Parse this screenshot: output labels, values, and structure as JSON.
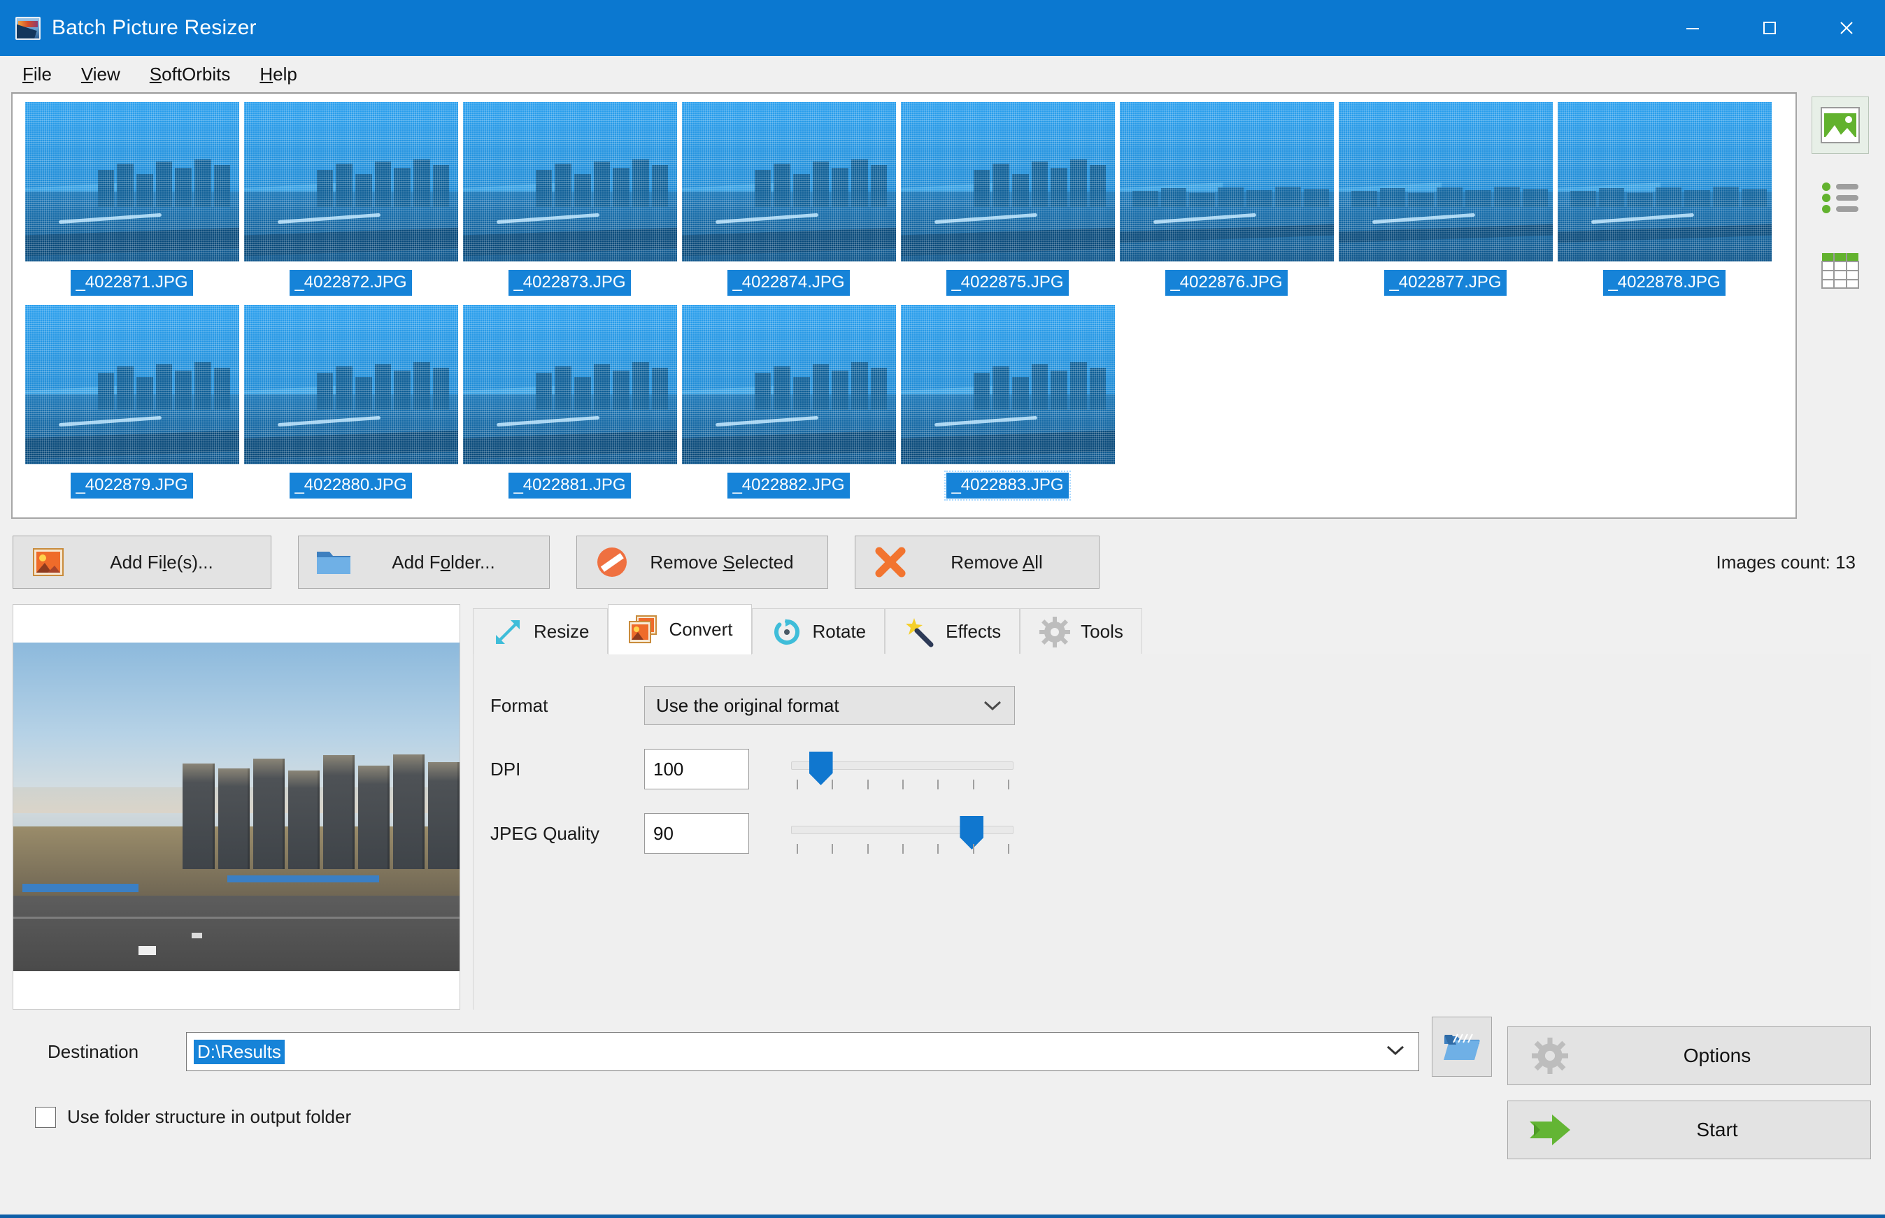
{
  "window": {
    "title": "Batch Picture Resizer",
    "icon": "app-picture-icon",
    "controls": {
      "minimize": "minimize",
      "maximize": "maximize",
      "close": "close"
    }
  },
  "menubar": {
    "items": [
      {
        "label": "File",
        "mnemonic": "F"
      },
      {
        "label": "View",
        "mnemonic": "V"
      },
      {
        "label": "SoftOrbits",
        "mnemonic": "S"
      },
      {
        "label": "Help",
        "mnemonic": "H"
      }
    ]
  },
  "file_list": {
    "images": [
      {
        "name": "_4022871.JPG",
        "selected": true,
        "variant": "near"
      },
      {
        "name": "_4022872.JPG",
        "selected": true,
        "variant": "near"
      },
      {
        "name": "_4022873.JPG",
        "selected": true,
        "variant": "near"
      },
      {
        "name": "_4022874.JPG",
        "selected": true,
        "variant": "near"
      },
      {
        "name": "_4022875.JPG",
        "selected": true,
        "variant": "near"
      },
      {
        "name": "_4022876.JPG",
        "selected": true,
        "variant": "flat"
      },
      {
        "name": "_4022877.JPG",
        "selected": true,
        "variant": "flat"
      },
      {
        "name": "_4022878.JPG",
        "selected": true,
        "variant": "flat"
      },
      {
        "name": "_4022879.JPG",
        "selected": true,
        "variant": "near"
      },
      {
        "name": "_4022880.JPG",
        "selected": true,
        "variant": "near"
      },
      {
        "name": "_4022881.JPG",
        "selected": true,
        "variant": "near"
      },
      {
        "name": "_4022882.JPG",
        "selected": true,
        "variant": "near"
      },
      {
        "name": "_4022883.JPG",
        "selected": true,
        "variant": "near",
        "focused": true
      }
    ]
  },
  "view_toolbar": {
    "buttons": [
      {
        "icon": "thumbnail-view-icon",
        "active": true
      },
      {
        "icon": "list-view-icon",
        "active": false
      },
      {
        "icon": "details-view-icon",
        "active": false
      }
    ]
  },
  "actions": {
    "add_files": {
      "label": "Add File(s)...",
      "mnemonic": "l",
      "icon": "picture-icon"
    },
    "add_folder": {
      "label": "Add Folder...",
      "mnemonic": "o",
      "icon": "folder-icon"
    },
    "remove_selected": {
      "label": "Remove Selected",
      "mnemonic": "S",
      "icon": "prohibition-icon"
    },
    "remove_all": {
      "label": "Remove All",
      "mnemonic": "A",
      "icon": "cross-icon"
    },
    "images_count": "Images count: 13"
  },
  "tabs": [
    {
      "label": "Resize",
      "icon": "resize-arrows-icon",
      "active": false
    },
    {
      "label": "Convert",
      "icon": "convert-pictures-icon",
      "active": true
    },
    {
      "label": "Rotate",
      "icon": "rotate-circle-icon",
      "active": false
    },
    {
      "label": "Effects",
      "icon": "magic-wand-icon",
      "active": false
    },
    {
      "label": "Tools",
      "icon": "gear-icon",
      "active": false
    }
  ],
  "convert_panel": {
    "format": {
      "label": "Format",
      "value": "Use the original format",
      "options": [
        "Use the original format"
      ]
    },
    "dpi": {
      "label": "DPI",
      "value": "100",
      "slider_percent": 9,
      "ticks": 7
    },
    "jpeg_quality": {
      "label": "JPEG Quality",
      "value": "90",
      "slider_percent": 85,
      "ticks": 7
    }
  },
  "destination": {
    "label": "Destination",
    "value": "D:\\Results",
    "browse_icon": "open-folder-icon"
  },
  "folder_structure": {
    "label": "Use folder structure in output folder",
    "checked": false
  },
  "footer_buttons": {
    "options": {
      "label": "Options",
      "icon": "gear-icon"
    },
    "start": {
      "label": "Start",
      "icon": "green-arrow-icon"
    }
  },
  "colors": {
    "title_bar": "#0b78d0",
    "selection": "#1683d8",
    "accent_blue": "#1077cf",
    "window_bg": "#f0f0f0",
    "start_green": "#63b534",
    "remove_orange": "#ef7040"
  }
}
